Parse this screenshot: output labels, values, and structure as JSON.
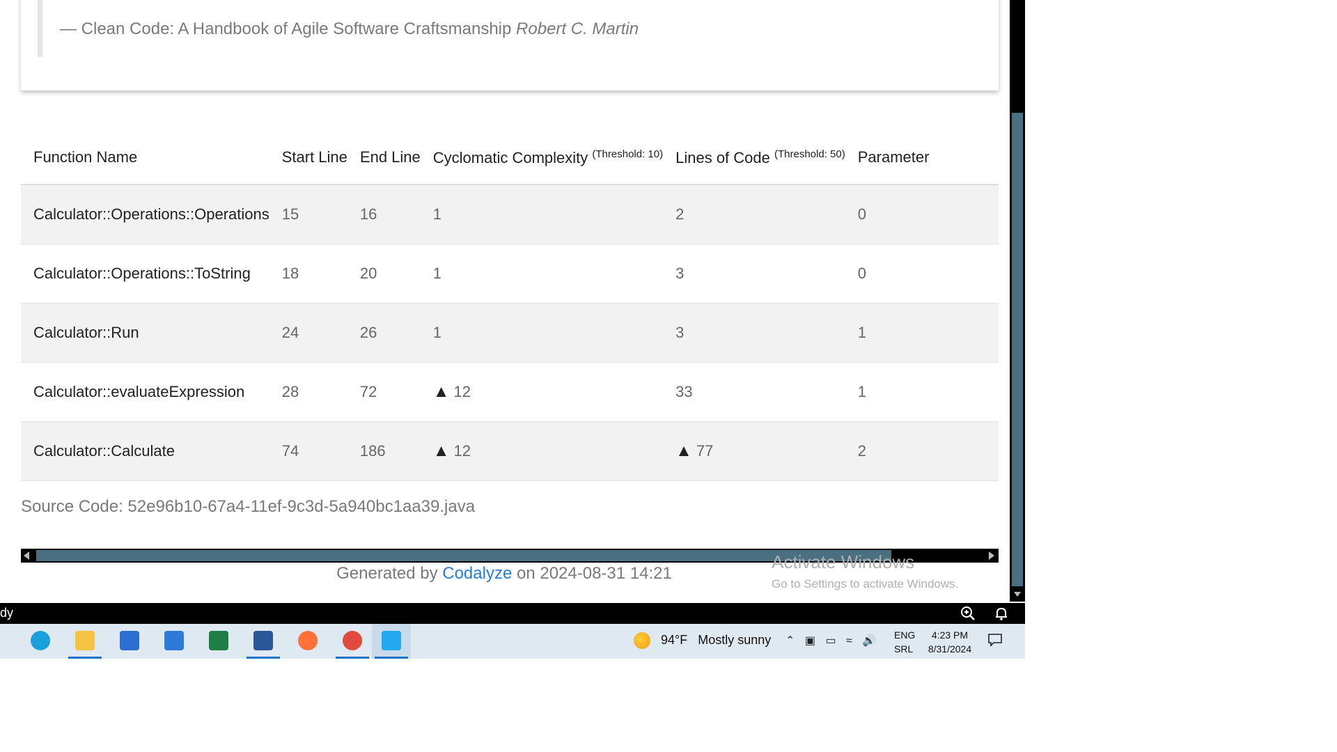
{
  "quote": {
    "source": "— Clean Code: A Handbook of Agile Software Craftsmanship",
    "author": "Robert C. Martin"
  },
  "table": {
    "headers": {
      "function_name": "Function Name",
      "start_line": "Start Line",
      "end_line": "End Line",
      "cyclomatic": "Cyclomatic Complexity",
      "cyclomatic_threshold": "(Threshold: 10)",
      "loc": "Lines of Code",
      "loc_threshold": "(Threshold: 50)",
      "parameters": "Parameter"
    },
    "rows": [
      {
        "name": "Calculator::Operations::Operations",
        "start": "15",
        "end": "16",
        "cc": "1",
        "cc_warn": false,
        "loc": "2",
        "loc_warn": false,
        "params": "0"
      },
      {
        "name": "Calculator::Operations::ToString",
        "start": "18",
        "end": "20",
        "cc": "1",
        "cc_warn": false,
        "loc": "3",
        "loc_warn": false,
        "params": "0"
      },
      {
        "name": "Calculator::Run",
        "start": "24",
        "end": "26",
        "cc": "1",
        "cc_warn": false,
        "loc": "3",
        "loc_warn": false,
        "params": "1"
      },
      {
        "name": "Calculator::evaluateExpression",
        "start": "28",
        "end": "72",
        "cc": "12",
        "cc_warn": true,
        "loc": "33",
        "loc_warn": false,
        "params": "1"
      },
      {
        "name": "Calculator::Calculate",
        "start": "74",
        "end": "186",
        "cc": "12",
        "cc_warn": true,
        "loc": "77",
        "loc_warn": true,
        "params": "2"
      }
    ],
    "warning_icon": "warning-triangle-icon"
  },
  "source_line": "Source Code: 52e96b10-67a4-11ef-9c3d-5a940bc1aa39.java",
  "footer": {
    "prefix": "Generated by",
    "link": "Codalyze",
    "suffix": "on 2024-08-31 14:21"
  },
  "watermark": {
    "title": "Activate Windows",
    "subtitle": "Go to Settings to activate Windows."
  },
  "statusbar": {
    "text": "dy",
    "zoom_icon": "zoom-icon",
    "bell_icon": "bell-icon"
  },
  "taskbar": {
    "apps": [
      {
        "name": "edge",
        "color": "#1aa0dc"
      },
      {
        "name": "file-explorer",
        "color": "#f5c242"
      },
      {
        "name": "microsoft-store",
        "color": "#2a6fd1"
      },
      {
        "name": "mail",
        "color": "#2d7ad9"
      },
      {
        "name": "excel",
        "color": "#1e7e45"
      },
      {
        "name": "word",
        "color": "#2b5797"
      },
      {
        "name": "firefox",
        "color": "#ff7139"
      },
      {
        "name": "chrome",
        "color": "#e04a3f"
      },
      {
        "name": "vscode",
        "color": "#23a8f2"
      }
    ],
    "weather_temp": "94°F",
    "weather_text": "Mostly sunny",
    "lang_top": "ENG",
    "lang_bottom": "SRL",
    "time": "4:23 PM",
    "date": "8/31/2024"
  },
  "colors": {
    "scroll_thumb": "#4a6f80",
    "link": "#2a7fd4",
    "row_alt": "#f2f2f2"
  }
}
